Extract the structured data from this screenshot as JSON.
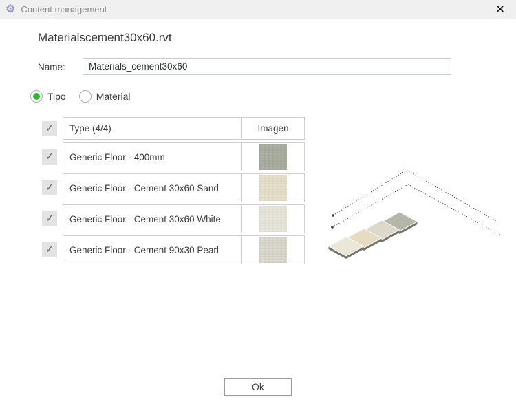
{
  "window": {
    "title": "Content management"
  },
  "icons": {
    "gear": "⚙",
    "close": "✕",
    "check": "✓"
  },
  "header": {
    "filename": "Materialscement30x60.rvt"
  },
  "form": {
    "name_label": "Name:",
    "name_value": "Materials_cement30x60"
  },
  "radios": {
    "options": [
      {
        "label": "Tipo",
        "selected": true
      },
      {
        "label": "Material",
        "selected": false
      }
    ]
  },
  "table": {
    "type_header": "Type (4/4)",
    "image_header": "Imagen",
    "header_checked": true,
    "rows": [
      {
        "label": "Generic Floor - 400mm",
        "checked": true,
        "thumb_color": "#a9ada0"
      },
      {
        "label": "Generic Floor - Cement 30x60 Sand",
        "checked": true,
        "thumb_color": "#e7e0ca"
      },
      {
        "label": "Generic Floor - Cement 30x60 White",
        "checked": true,
        "thumb_color": "#e9e7db"
      },
      {
        "label": "Generic Floor - Cement 90x30 Pearl",
        "checked": true,
        "thumb_color": "#dbd8cd"
      }
    ]
  },
  "preview": {
    "line_color": "#3c3c3c",
    "tile_side_color": "#73736b",
    "tiles": [
      {
        "name": "white tile",
        "color": "#eae7d9"
      },
      {
        "name": "sand tile",
        "color": "#e5dcc2"
      },
      {
        "name": "pearl tile",
        "color": "#dcd9cc"
      },
      {
        "name": "gray tile",
        "color": "#b4b6a8"
      }
    ]
  },
  "footer": {
    "ok_label": "Ok"
  },
  "colors": {
    "titlebar_bg": "#f0f0f0",
    "radio_selected": "#2db52d",
    "gear_color": "#9495c5"
  }
}
